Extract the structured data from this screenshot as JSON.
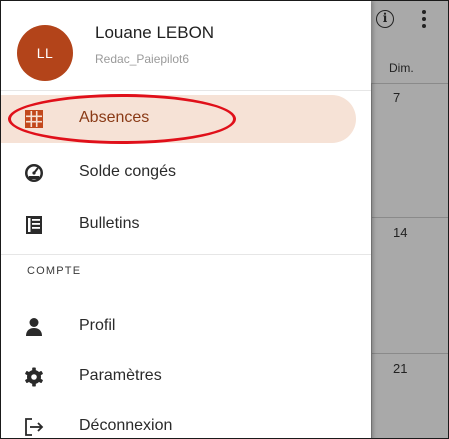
{
  "user": {
    "initials": "LL",
    "name": "Louane LEBON",
    "subtitle": "Redac_Paiepilot6"
  },
  "menu": {
    "items": [
      {
        "id": "absences",
        "label": "Absences",
        "icon": "grid-icon",
        "active": true
      },
      {
        "id": "solde",
        "label": "Solde congés",
        "icon": "gauge-icon",
        "active": false
      },
      {
        "id": "bulletins",
        "label": "Bulletins",
        "icon": "document-list-icon",
        "active": false
      }
    ],
    "section_title": "COMPTE",
    "account_items": [
      {
        "id": "profil",
        "label": "Profil",
        "icon": "person-icon"
      },
      {
        "id": "parametres",
        "label": "Paramètres",
        "icon": "gear-icon"
      },
      {
        "id": "deconnexion",
        "label": "Déconnexion",
        "icon": "logout-icon"
      }
    ]
  },
  "calendar": {
    "day_label": "Dim.",
    "days": [
      "7",
      "14",
      "21"
    ]
  },
  "colors": {
    "avatar": "#b3441a",
    "active_bg": "#f6e2d6",
    "active_icon": "#c2481c",
    "annotation": "#e0101a"
  }
}
